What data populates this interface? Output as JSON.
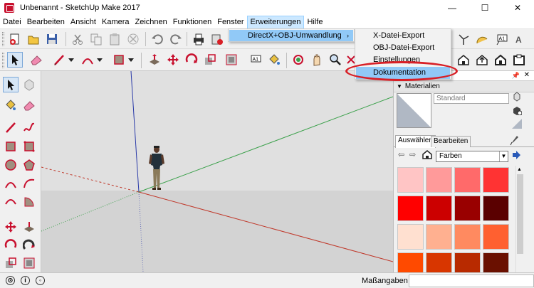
{
  "window": {
    "title": "Unbenannt - SketchUp Make 2017",
    "minimize": "—",
    "maximize": "☐",
    "close": "✕"
  },
  "menubar": {
    "items": [
      "Datei",
      "Bearbeiten",
      "Ansicht",
      "Kamera",
      "Zeichnen",
      "Funktionen",
      "Fenster",
      "Erweiterungen",
      "Hilfe"
    ]
  },
  "extensions_menu": {
    "item": "DirectX+OBJ-Umwandlung",
    "arrow": "›"
  },
  "submenu": {
    "items": [
      "X-Datei-Export",
      "OBJ-Datei-Export",
      "Einstellungen",
      "Dokumentation"
    ],
    "highlighted": "Dokumentation",
    "annotation_color": "#d81f26"
  },
  "panel": {
    "materials_title": "Materialien",
    "material_name_placeholder": "Standard",
    "tabs": [
      "Auswählen",
      "Bearbeiten"
    ],
    "library_select": "Farben",
    "swatch_colors": [
      "#ffc5c5",
      "#ff9a9a",
      "#ff6a6a",
      "#ff3333",
      "#ff0000",
      "#cc0000",
      "#990000",
      "#5a0000",
      "#ffe0d0",
      "#ffb090",
      "#ff8a60",
      "#ff6030",
      "#ff4a00",
      "#d83600",
      "#b82a00",
      "#6a1000"
    ]
  },
  "statusbar": {
    "measurements_label": "Maßangaben",
    "icons": [
      "geo-location-icon",
      "credits-icon",
      "user-icon"
    ]
  },
  "colors": {
    "axis_red": "#c0392b",
    "axis_green": "#3aa04a",
    "axis_blue": "#2a3aa8",
    "menu_highlight": "#91c9f7"
  }
}
